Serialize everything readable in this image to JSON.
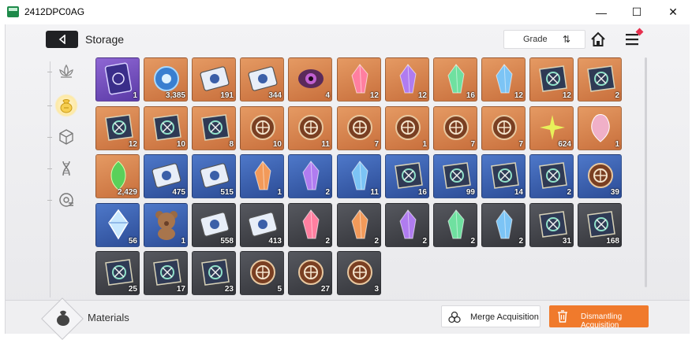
{
  "window": {
    "title": "2412DPC0AG",
    "min_glyph": "—",
    "max_glyph": "☐",
    "close_glyph": "✕"
  },
  "header": {
    "title": "Storage",
    "grade_label": "Grade",
    "sort_glyph": "⇅"
  },
  "sidebar": {
    "items": [
      {
        "icon": "lotus-icon",
        "active": false
      },
      {
        "icon": "bag-icon",
        "active": true
      },
      {
        "icon": "cube-icon",
        "active": false
      },
      {
        "icon": "dna-icon",
        "active": false
      },
      {
        "icon": "disc-icon",
        "active": false
      }
    ]
  },
  "items": [
    {
      "grade": "purple",
      "icon": "card-icon",
      "qty": "1"
    },
    {
      "grade": "orange",
      "icon": "orb-icon",
      "qty": "3,385"
    },
    {
      "grade": "orange",
      "icon": "ticket-icon",
      "qty": "191"
    },
    {
      "grade": "orange",
      "icon": "ticket-icon",
      "qty": "344"
    },
    {
      "grade": "orange",
      "icon": "eye-icon",
      "qty": "4"
    },
    {
      "grade": "orange",
      "icon": "crystal-pink-icon",
      "qty": "12"
    },
    {
      "grade": "orange",
      "icon": "crystal-purple-icon",
      "qty": "12"
    },
    {
      "grade": "orange",
      "icon": "crystal-green-icon",
      "qty": "16"
    },
    {
      "grade": "orange",
      "icon": "crystal-blue-icon",
      "qty": "12"
    },
    {
      "grade": "orange",
      "icon": "book-icon",
      "qty": "12"
    },
    {
      "grade": "orange",
      "icon": "book-icon",
      "qty": "2"
    },
    {
      "grade": "orange",
      "icon": "book-icon",
      "qty": "12"
    },
    {
      "grade": "orange",
      "icon": "book-icon",
      "qty": "10"
    },
    {
      "grade": "orange",
      "icon": "book-icon",
      "qty": "8"
    },
    {
      "grade": "orange",
      "icon": "medal-icon",
      "qty": "10"
    },
    {
      "grade": "orange",
      "icon": "medal-icon",
      "qty": "11"
    },
    {
      "grade": "orange",
      "icon": "medal-icon",
      "qty": "7"
    },
    {
      "grade": "orange",
      "icon": "medal-icon",
      "qty": "1"
    },
    {
      "grade": "orange",
      "icon": "medal-icon",
      "qty": "7"
    },
    {
      "grade": "orange",
      "icon": "medal-icon",
      "qty": "7"
    },
    {
      "grade": "orange",
      "icon": "sparkle-icon",
      "qty": "624"
    },
    {
      "grade": "orange",
      "icon": "gem-drop-icon",
      "qty": "1"
    },
    {
      "grade": "orange",
      "icon": "leaf-gem-icon",
      "qty": "2,429"
    },
    {
      "grade": "blue",
      "icon": "ticket-icon",
      "qty": "475"
    },
    {
      "grade": "blue",
      "icon": "ticket-icon",
      "qty": "515"
    },
    {
      "grade": "blue",
      "icon": "crystal-orange-icon",
      "qty": "1"
    },
    {
      "grade": "blue",
      "icon": "crystal-purple-icon",
      "qty": "2"
    },
    {
      "grade": "blue",
      "icon": "crystal-blue-icon",
      "qty": "11"
    },
    {
      "grade": "blue",
      "icon": "book-icon",
      "qty": "16"
    },
    {
      "grade": "blue",
      "icon": "book-icon",
      "qty": "99"
    },
    {
      "grade": "blue",
      "icon": "book-icon",
      "qty": "14"
    },
    {
      "grade": "blue",
      "icon": "book-icon",
      "qty": "2"
    },
    {
      "grade": "blue",
      "icon": "medal-icon",
      "qty": "39"
    },
    {
      "grade": "blue",
      "icon": "crystal-shard-icon",
      "qty": "56"
    },
    {
      "grade": "blue",
      "icon": "teddy-bear-icon",
      "qty": "1"
    },
    {
      "grade": "gray",
      "icon": "ticket-icon",
      "qty": "558"
    },
    {
      "grade": "gray",
      "icon": "ticket-icon",
      "qty": "413"
    },
    {
      "grade": "gray",
      "icon": "crystal-pink-icon",
      "qty": "2"
    },
    {
      "grade": "gray",
      "icon": "crystal-orange-icon",
      "qty": "2"
    },
    {
      "grade": "gray",
      "icon": "crystal-purple-icon",
      "qty": "2"
    },
    {
      "grade": "gray",
      "icon": "crystal-green-icon",
      "qty": "2"
    },
    {
      "grade": "gray",
      "icon": "crystal-blue-icon",
      "qty": "2"
    },
    {
      "grade": "gray",
      "icon": "book-icon",
      "qty": "31"
    },
    {
      "grade": "gray",
      "icon": "book-icon",
      "qty": "168"
    },
    {
      "grade": "gray",
      "icon": "book-icon",
      "qty": "25"
    },
    {
      "grade": "gray",
      "icon": "book-icon",
      "qty": "17"
    },
    {
      "grade": "gray",
      "icon": "book-icon",
      "qty": "23"
    },
    {
      "grade": "gray",
      "icon": "medal-icon",
      "qty": "5"
    },
    {
      "grade": "gray",
      "icon": "medal-icon",
      "qty": "27"
    },
    {
      "grade": "gray",
      "icon": "medal-icon",
      "qty": "3"
    }
  ],
  "footer": {
    "category_label": "Materials",
    "merge_label": "Merge Acquisition",
    "dismantle_label": "Dismantling Acquisition"
  },
  "colors": {
    "accent_orange": "#f07a2c",
    "grade_orange": "#d8844a",
    "grade_purple": "#7552bf",
    "grade_blue": "#3c62b0",
    "grade_gray": "#45474d"
  }
}
